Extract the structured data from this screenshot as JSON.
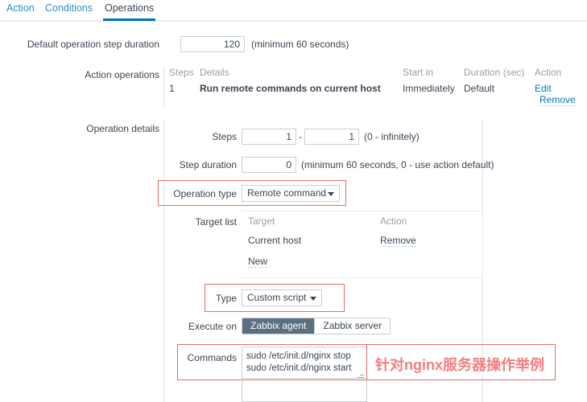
{
  "tabs": [
    {
      "id": "action",
      "label": "Action",
      "active": false
    },
    {
      "id": "conditions",
      "label": "Conditions",
      "active": false
    },
    {
      "id": "operations",
      "label": "Operations",
      "active": true
    }
  ],
  "default_step": {
    "label": "Default operation step duration",
    "value": "120",
    "hint": "(minimum 60 seconds)"
  },
  "action_operations": {
    "label": "Action operations",
    "headers": [
      "Steps",
      "Details",
      "Start in",
      "Duration (sec)",
      "Action"
    ],
    "rows": [
      {
        "steps": "1",
        "details": "Run remote commands on current host",
        "start_in": "Immediately",
        "duration": "Default",
        "actions": [
          "Edit",
          "Remove"
        ]
      }
    ]
  },
  "operation_details": {
    "label": "Operation details",
    "steps": {
      "label": "Steps",
      "from": "1",
      "separator": "-",
      "to": "1",
      "hint": "(0 - infinitely)"
    },
    "step_duration": {
      "label": "Step duration",
      "value": "0",
      "hint": "(minimum 60 seconds, 0 - use action default)"
    },
    "operation_type": {
      "label": "Operation type",
      "value": "Remote command"
    },
    "target_list": {
      "label": "Target list",
      "headers": [
        "Target",
        "Action"
      ],
      "rows": [
        {
          "target": "Current host",
          "action": "Remove"
        }
      ],
      "new_link": "New"
    },
    "type": {
      "label": "Type",
      "value": "Custom script"
    },
    "execute_on": {
      "label": "Execute on",
      "options": [
        "Zabbix agent",
        "Zabbix server"
      ],
      "selected": "Zabbix agent"
    },
    "commands": {
      "label": "Commands",
      "value": "sudo /etc/init.d/nginx stop\nsudo /etc/init.d/nginx start"
    }
  },
  "annotation": {
    "text": "针对nginx服务器操作举例",
    "color": "#f2807f",
    "box_color": "#e26d6d"
  },
  "colors": {
    "link": "#0275b8",
    "tab_active_underline": "#0275b8",
    "segment_selected_bg": "#5b6f81",
    "text": "#3b4552",
    "muted": "#97a0a8",
    "border": "#c9d0d7"
  }
}
